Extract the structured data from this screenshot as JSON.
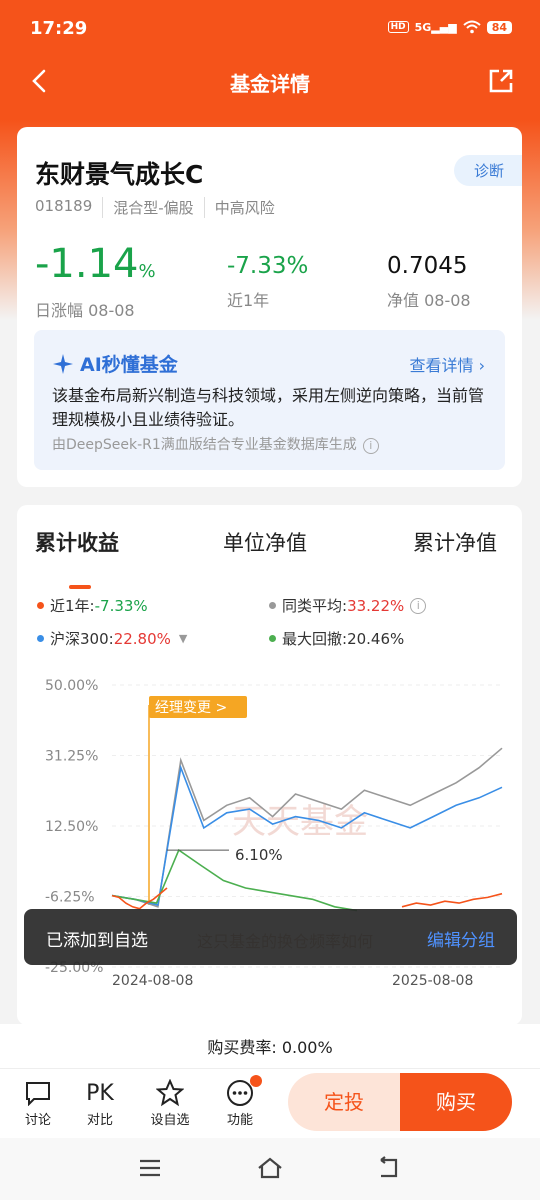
{
  "status": {
    "time": "17:29",
    "network": "5G",
    "battery": "84",
    "hd": "HD"
  },
  "nav": {
    "title": "基金详情"
  },
  "fund": {
    "name": "东财景气成长C",
    "diag_label": "诊断",
    "code": "018189",
    "type": "混合型-偏股",
    "risk": "中高风险",
    "daily_change": "-1.14",
    "daily_change_unit": "%",
    "daily_label": "日涨幅 08-08",
    "year_change": "-7.33%",
    "year_label": "近1年",
    "nav_value": "0.7045",
    "nav_label": "净值 08-08"
  },
  "ai": {
    "title": "AI秒懂基金",
    "more": "查看详情 ›",
    "text": "该基金布局新兴制造与科技领域，采用左侧逆向策略，当前管理规模极小且业绩待验证。",
    "source": "由DeepSeek-R1满血版结合专业基金数据库生成"
  },
  "chart_tabs": [
    "累计收益",
    "单位净值",
    "累计净值"
  ],
  "legend": {
    "fund_label": "近1年:",
    "fund_value": "-7.33%",
    "peer_label": "同类平均:",
    "peer_value": "33.22%",
    "index_label": "沪深300:",
    "index_value": "22.80%",
    "drawdown_label": "最大回撤:",
    "drawdown_value": "20.46%",
    "colors": {
      "fund": "#f5531a",
      "peer": "#999999",
      "index": "#3a8ee6",
      "drawdown": "#4caf50"
    }
  },
  "chart_overlay": {
    "manager_change": "经理变更 >",
    "drawdown_point": "6.10%",
    "watermark": "天天基金",
    "hint": "这只基金的换仓频率如何"
  },
  "chart_data": {
    "type": "line",
    "yticks": [
      "50.00%",
      "31.25%",
      "12.50%",
      "-6.25%",
      "-25.00%"
    ],
    "ylim": [
      -25,
      50
    ],
    "x_start": "2024-08-08",
    "x_end": "2025-08-08",
    "series": [
      {
        "name": "近1年",
        "values": [
          -6.0,
          -6.5,
          -8.0,
          -9.0,
          -9.5,
          -8.0,
          -7.0,
          -5.5,
          -4.0
        ]
      },
      {
        "name": "同类平均",
        "values": [
          -6.0,
          -7.0,
          -9.0,
          30.0,
          14.0,
          18.0,
          20.0,
          15.0,
          21.0,
          19.0,
          17.0,
          22.0,
          20.0,
          18.0,
          21.0,
          24.0,
          28.0,
          33.2
        ]
      },
      {
        "name": "沪深300",
        "values": [
          -6.0,
          -7.0,
          -8.5,
          28.0,
          12.0,
          16.0,
          17.0,
          13.0,
          15.0,
          14.0,
          12.0,
          16.0,
          14.0,
          12.0,
          15.0,
          18.0,
          20.0,
          22.8
        ]
      },
      {
        "name": "最大回撤",
        "values": [
          -6.0,
          -7.0,
          -8.0,
          6.1,
          2.0,
          -2.0,
          -4.0,
          -5.0,
          -6.0,
          -7.0,
          -9.0,
          -10.0
        ]
      }
    ]
  },
  "toast": {
    "message": "已添加到自选",
    "action": "编辑分组"
  },
  "fee": {
    "text": "购买费率: 0.00%"
  },
  "bottom": {
    "discuss": "讨论",
    "compare": "对比",
    "compare_icon": "PK",
    "watchlist": "设自选",
    "function": "功能",
    "ding": "定投",
    "buy": "购买"
  }
}
